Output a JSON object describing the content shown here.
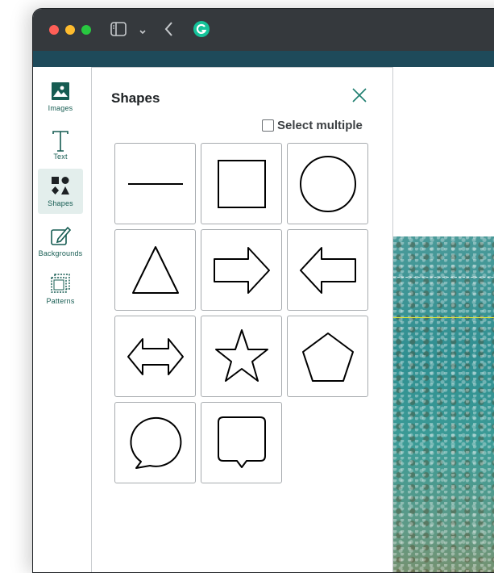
{
  "sidebar": {
    "items": [
      {
        "label": "Images",
        "icon": "image-icon",
        "active": false
      },
      {
        "label": "Text",
        "icon": "text-icon",
        "active": false
      },
      {
        "label": "Shapes",
        "icon": "shapes-icon",
        "active": true
      },
      {
        "label": "Backgrounds",
        "icon": "backgrounds-icon",
        "active": false
      },
      {
        "label": "Patterns",
        "icon": "patterns-icon",
        "active": false
      }
    ]
  },
  "panel": {
    "title": "Shapes",
    "select_multiple_label": "Select multiple",
    "select_multiple_checked": false,
    "shapes": [
      "line",
      "square",
      "circle",
      "triangle",
      "arrow-right",
      "arrow-left",
      "double-arrow",
      "star",
      "pentagon",
      "speech-bubble-round",
      "speech-bubble-square"
    ]
  },
  "colors": {
    "accent": "#165c52",
    "titlebar": "#35393d",
    "banner": "#1e4a5a",
    "active_bg": "#e3eeec"
  }
}
